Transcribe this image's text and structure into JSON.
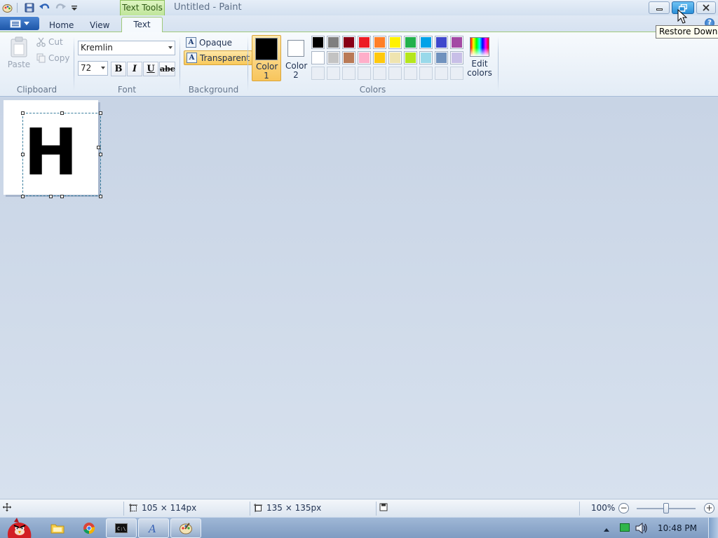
{
  "window": {
    "title": "Untitled - Paint",
    "contextual_tab": "Text Tools",
    "tooltip": "Restore Down"
  },
  "tabs": [
    {
      "label": "Home"
    },
    {
      "label": "View"
    },
    {
      "label": "Text",
      "active": true
    }
  ],
  "clipboard": {
    "group_label": "Clipboard",
    "paste": "Paste",
    "cut": "Cut",
    "copy": "Copy"
  },
  "font": {
    "group_label": "Font",
    "family": "Kremlin",
    "size": "72",
    "bold": "B",
    "italic": "I",
    "underline": "U",
    "strikethrough": "abc"
  },
  "background": {
    "group_label": "Background",
    "opaque": "Opaque",
    "transparent": "Transparent",
    "selected": "transparent"
  },
  "colors": {
    "group_label": "Colors",
    "color1_label": "Color 1",
    "color2_label": "Color 2",
    "color1": "#000000",
    "color2": "#ffffff",
    "edit_colors": "Edit colors",
    "palette_row1": [
      "#000000",
      "#7f7f7f",
      "#880015",
      "#ed1c24",
      "#ff7f27",
      "#fff200",
      "#22b14c",
      "#00a2e8",
      "#3f48cc",
      "#a349a4"
    ],
    "palette_row2": [
      "#ffffff",
      "#c3c3c3",
      "#b97a57",
      "#ffaec9",
      "#ffc90e",
      "#efe4b0",
      "#b5e61d",
      "#99d9ea",
      "#7092be",
      "#c8bfe7"
    ]
  },
  "canvas": {
    "text": "H"
  },
  "status": {
    "selection_size": "105 × 114px",
    "image_size": "135 × 135px",
    "zoom": "100%"
  },
  "taskbar": {
    "clock": "10:48 PM"
  }
}
